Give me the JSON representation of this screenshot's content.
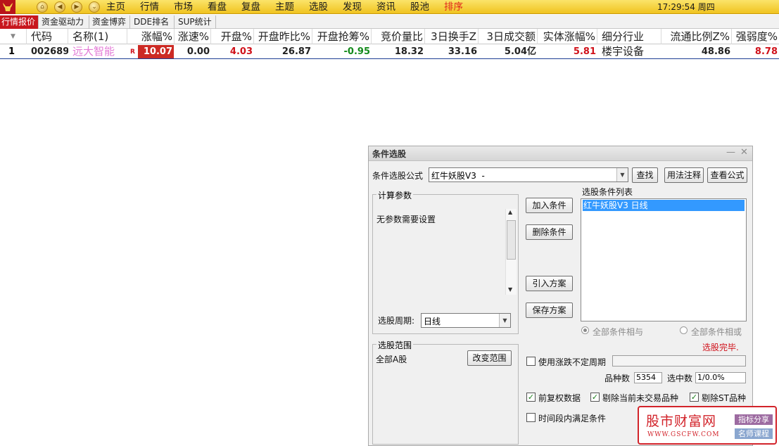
{
  "menu": {
    "items": [
      "主页",
      "行情",
      "市场",
      "看盘",
      "复盘",
      "主题",
      "选股",
      "发现",
      "资讯",
      "股池",
      "排序"
    ],
    "active_item": "排序",
    "clock": "17:29:54 周四"
  },
  "tabs": [
    "行情报价",
    "资金驱动力",
    "资金博弈",
    "DDE排名",
    "SUP统计"
  ],
  "table": {
    "headers": [
      "代码",
      "名称(1)",
      "涨幅%",
      "涨速%",
      "开盘%",
      "开盘昨比%",
      "开盘抢筹%",
      "竞价量比",
      "3日换手Z",
      "3日成交额",
      "实体涨幅%",
      "细分行业",
      "流通比例Z%",
      "强弱度%"
    ],
    "row": {
      "index": "1",
      "code": "002689",
      "name": "远大智能",
      "flag": "R",
      "change_pct": "10.07",
      "speed": "0.00",
      "open_pct": "4.03",
      "open_vs_prev": "26.87",
      "open_grab": "-0.95",
      "auction_ratio": "18.32",
      "turnover3": "33.16",
      "amount3": "5.04亿",
      "body_pct": "5.81",
      "industry": "楼宇设备",
      "float_ratio": "48.86",
      "strength": "8.78"
    }
  },
  "dialog": {
    "title": "条件选股",
    "formula_label": "条件选股公式",
    "formula_value": "红牛妖股V3  -",
    "btn_find": "查找",
    "btn_usage": "用法注释",
    "btn_view": "查看公式",
    "params_group": "计算参数",
    "params_text": "无参数需要设置",
    "period_label": "选股周期:",
    "period_value": "日线",
    "btn_add": "加入条件",
    "btn_delete": "删除条件",
    "btn_import": "引入方案",
    "btn_save": "保存方案",
    "list_label": "选股条件列表",
    "list_items": [
      "红牛妖股V3  日线"
    ],
    "radio_and": "全部条件相与",
    "radio_or": "全部条件相或",
    "status": "选股完毕.",
    "scope_group": "选股范围",
    "scope_value": "全部A股",
    "btn_change_scope": "改变范围",
    "uncertain_period": "使用涨跌不定周期",
    "count_label": "品种数",
    "count_value": "5354",
    "selected_label": "选中数",
    "selected_value": "1/0.0%",
    "chk_fuquan": "前复权数据",
    "chk_exclude_untraded": "剔除当前未交易品种",
    "chk_exclude_st": "剔除ST品种",
    "chk_time_range": "时间段内满足条件"
  },
  "watermark": {
    "title": "股市财富网",
    "url": "WWW.GSCFW.COM",
    "tag1": "指标分享",
    "tag2": "名师课程"
  },
  "colors": {
    "up": "#d0121b",
    "down": "#138a1b",
    "menu_active": "#e0261b",
    "tab_active": "#c8161d",
    "list_select": "#3399ff"
  }
}
